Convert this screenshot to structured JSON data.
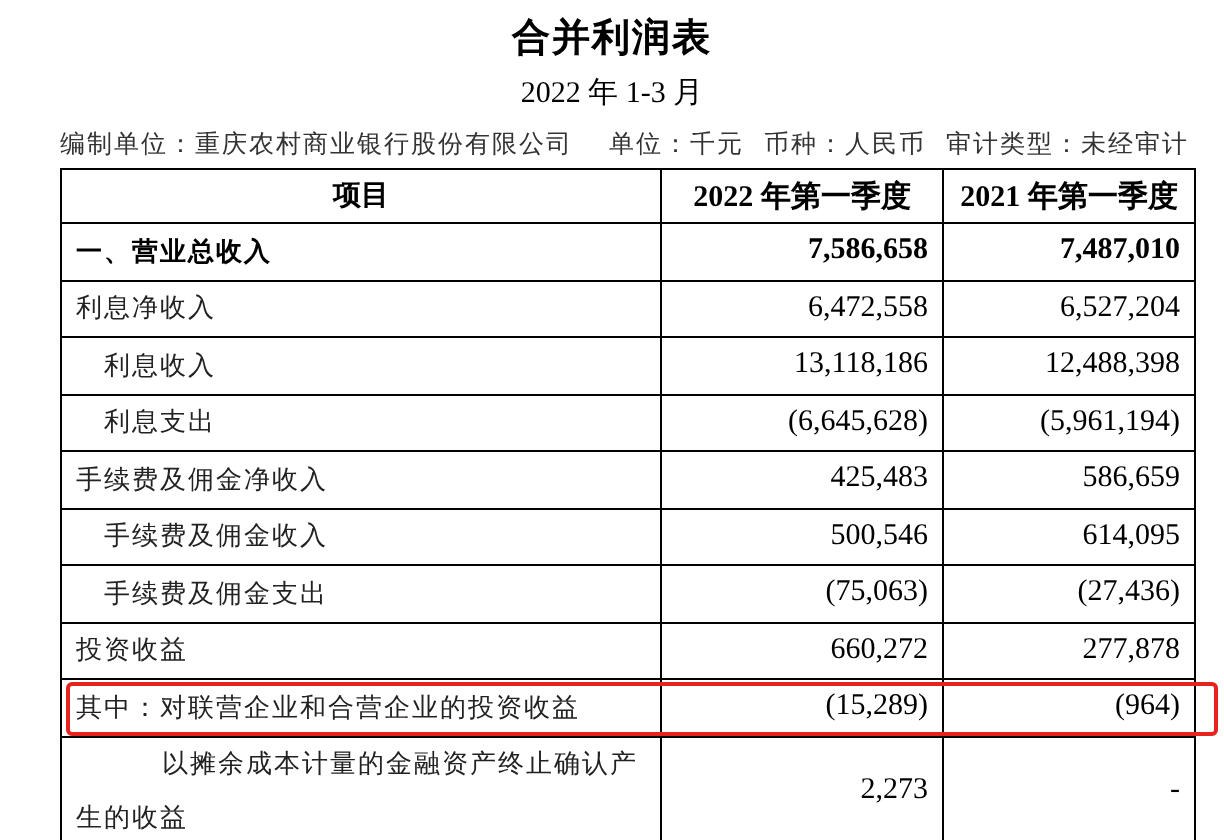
{
  "title": "合并利润表",
  "period": "2022 年 1-3 月",
  "info": [
    {
      "text": "编制单位：重庆农村商业银行股份有限公司"
    },
    {
      "text": "单位：千元"
    },
    {
      "text": "币种：人民币"
    },
    {
      "text": "审计类型：未经审计"
    }
  ],
  "table": {
    "columns": [
      "项目",
      "2022 年第一季度",
      "2021 年第一季度"
    ],
    "rows": [
      {
        "label": "一、营业总收入",
        "kind": "total",
        "highlighted": false,
        "values": [
          "7,586,658",
          "7,487,010"
        ]
      },
      {
        "label": "利息净收入",
        "kind": "item",
        "highlighted": false,
        "values": [
          "6,472,558",
          "6,527,204"
        ],
        "children": [
          {
            "label": "利息收入",
            "kind": "item",
            "highlighted": false,
            "values": [
              "13,118,186",
              "12,488,398"
            ]
          },
          {
            "label": "利息支出",
            "kind": "item",
            "highlighted": false,
            "values": [
              "(6,645,628)",
              "(5,961,194)"
            ]
          }
        ]
      },
      {
        "label": "手续费及佣金净收入",
        "kind": "item",
        "highlighted": false,
        "values": [
          "425,483",
          "586,659"
        ],
        "children": [
          {
            "label": "手续费及佣金收入",
            "kind": "item",
            "highlighted": false,
            "values": [
              "500,546",
              "614,095"
            ]
          },
          {
            "label": "手续费及佣金支出",
            "kind": "item",
            "highlighted": false,
            "values": [
              "(75,063)",
              "(27,436)"
            ]
          }
        ]
      },
      {
        "label": "投资收益",
        "kind": "item",
        "highlighted": false,
        "values": [
          "660,272",
          "277,878"
        ]
      },
      {
        "label": "其中：对联营企业和合营企业的投资收益",
        "kind": "item",
        "highlighted": true,
        "values": [
          "(15,289)",
          "(964)"
        ]
      },
      {
        "label": "以摊余成本计量的金融资产终止确认产生的收益",
        "kind": "note",
        "highlighted": false,
        "values": [
          "2,273",
          "-"
        ]
      }
    ]
  }
}
